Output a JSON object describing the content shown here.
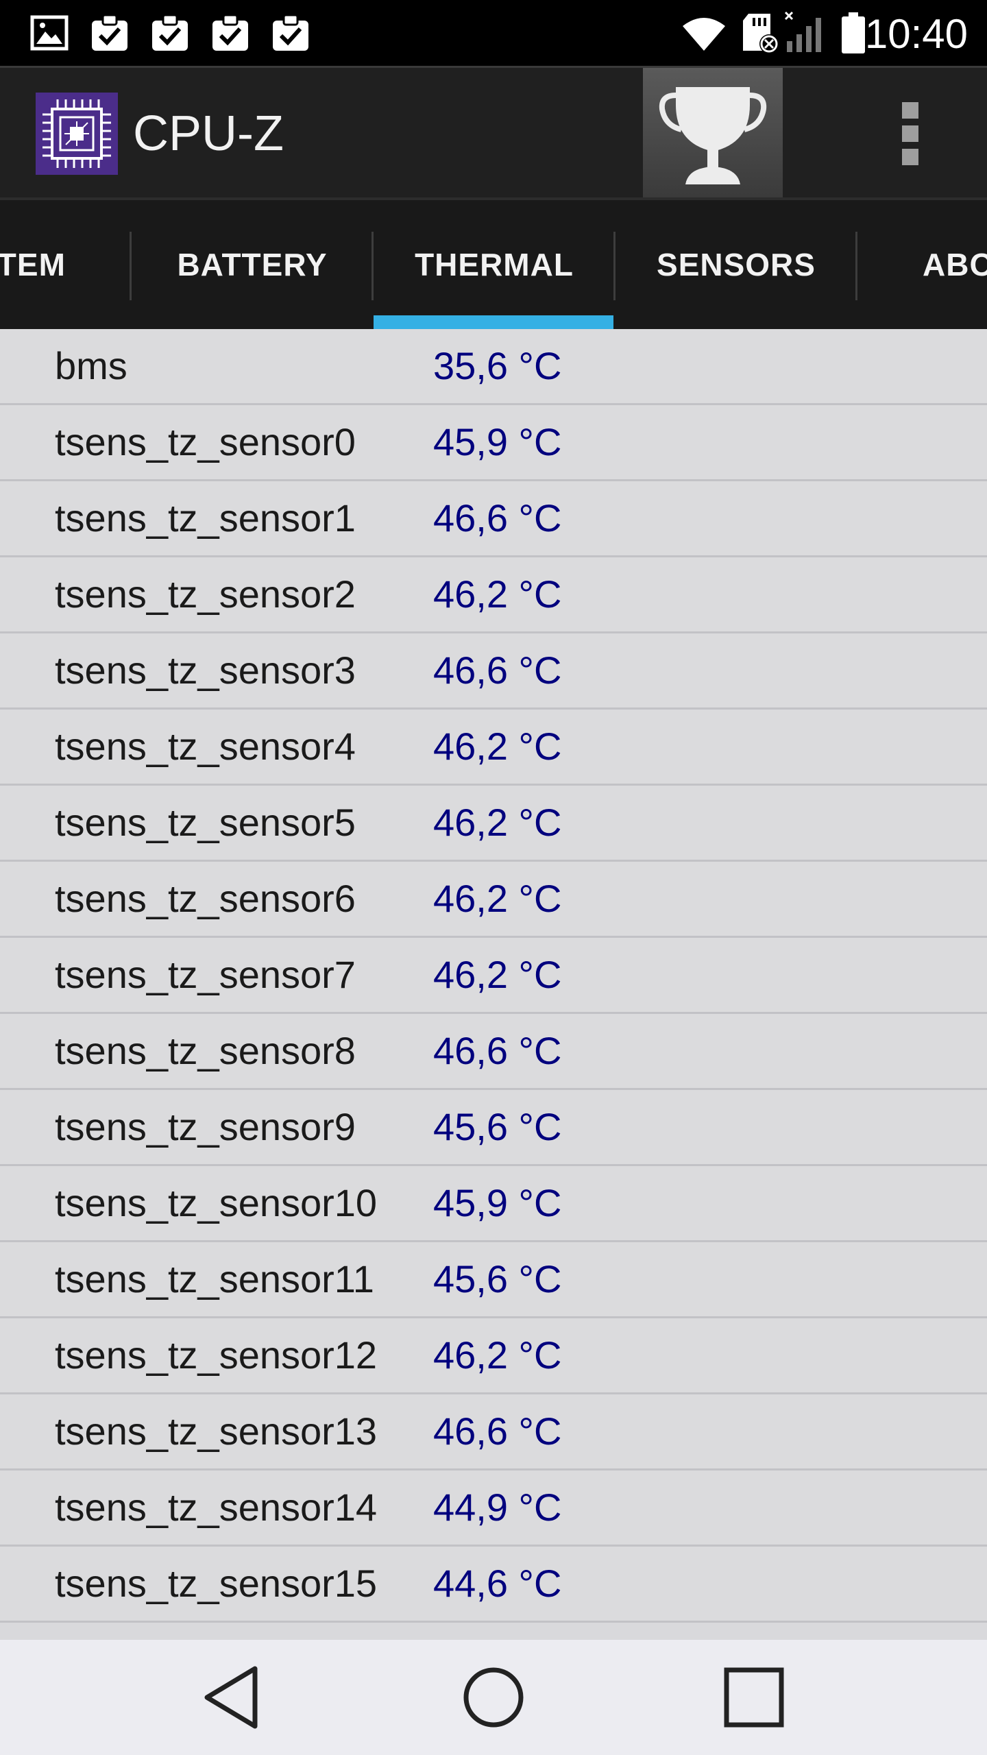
{
  "status_bar": {
    "time": "10:40",
    "icons": [
      "gallery-icon",
      "clipboard-check-icon",
      "clipboard-check-icon",
      "clipboard-check-icon",
      "clipboard-check-icon",
      "wifi-icon",
      "sd-card-icon",
      "signal-icon",
      "battery-icon"
    ]
  },
  "action_bar": {
    "title": "CPU-Z",
    "app_icon": "chip-icon",
    "trophy_icon": "trophy-icon",
    "overflow_icon": "more-vert-icon"
  },
  "tabs": [
    {
      "label": "STEM",
      "active": false
    },
    {
      "label": "BATTERY",
      "active": false
    },
    {
      "label": "THERMAL",
      "active": true
    },
    {
      "label": "SENSORS",
      "active": false
    },
    {
      "label": "ABO",
      "active": false
    }
  ],
  "colors": {
    "tab_indicator": "#35b0e4",
    "value_text": "#00007e",
    "app_icon_bg": "#4b2d8a"
  },
  "thermal_rows": [
    {
      "name": "bms",
      "value": "35,6 °C"
    },
    {
      "name": "tsens_tz_sensor0",
      "value": "45,9 °C"
    },
    {
      "name": "tsens_tz_sensor1",
      "value": "46,6 °C"
    },
    {
      "name": "tsens_tz_sensor2",
      "value": "46,2 °C"
    },
    {
      "name": "tsens_tz_sensor3",
      "value": "46,6 °C"
    },
    {
      "name": "tsens_tz_sensor4",
      "value": "46,2 °C"
    },
    {
      "name": "tsens_tz_sensor5",
      "value": "46,2 °C"
    },
    {
      "name": "tsens_tz_sensor6",
      "value": "46,2 °C"
    },
    {
      "name": "tsens_tz_sensor7",
      "value": "46,2 °C"
    },
    {
      "name": "tsens_tz_sensor8",
      "value": "46,6 °C"
    },
    {
      "name": "tsens_tz_sensor9",
      "value": "45,6 °C"
    },
    {
      "name": "tsens_tz_sensor10",
      "value": "45,9 °C"
    },
    {
      "name": "tsens_tz_sensor11",
      "value": "45,6 °C"
    },
    {
      "name": "tsens_tz_sensor12",
      "value": "46,2 °C"
    },
    {
      "name": "tsens_tz_sensor13",
      "value": "46,6 °C"
    },
    {
      "name": "tsens_tz_sensor14",
      "value": "44,9 °C"
    },
    {
      "name": "tsens_tz_sensor15",
      "value": "44,6 °C"
    }
  ],
  "nav_bar": {
    "back_icon": "back-icon",
    "home_icon": "home-icon",
    "recents_icon": "recents-icon"
  }
}
